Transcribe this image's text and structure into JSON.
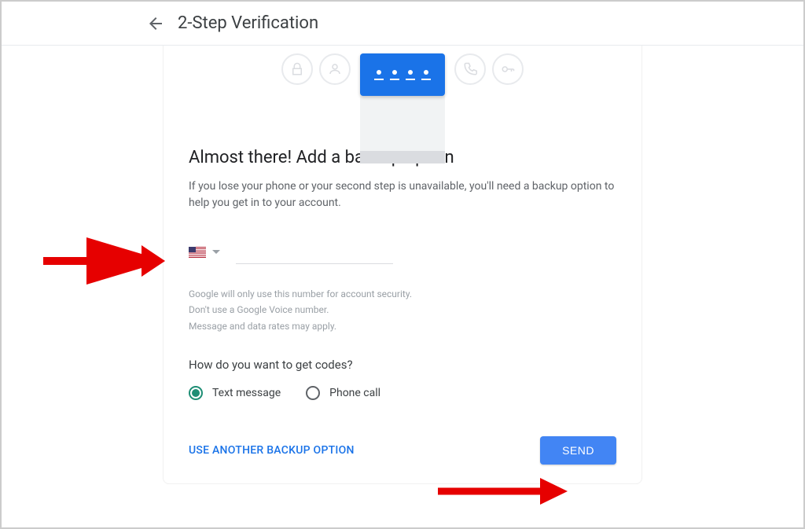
{
  "header": {
    "title": "2-Step Verification"
  },
  "main": {
    "heading": "Almost there! Add a backup option",
    "description": "If you lose your phone or your second step is unavailable, you'll need a backup option to help you get in to your account.",
    "country": "US",
    "disclaimer_line1": "Google will only use this number for account security.",
    "disclaimer_line2": "Don't use a Google Voice number.",
    "disclaimer_line3": "Message and data rates may apply.",
    "codes_question": "How do you want to get codes?",
    "radio": {
      "text_message": "Text message",
      "phone_call": "Phone call",
      "selected": "text_message"
    },
    "actions": {
      "another_option": "USE ANOTHER BACKUP OPTION",
      "send": "SEND"
    }
  }
}
